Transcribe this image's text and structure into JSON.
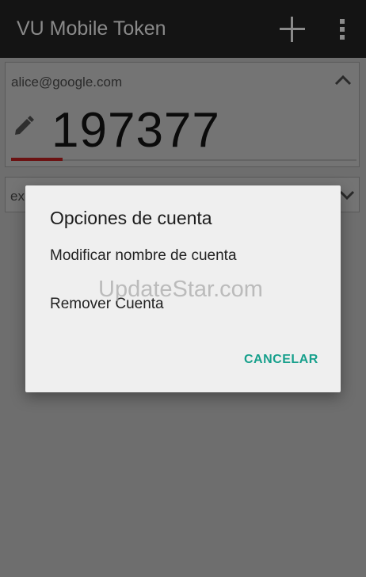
{
  "app": {
    "title": "VU Mobile Token",
    "icons": {
      "add": "plus-icon",
      "menu": "overflow-menu-icon"
    }
  },
  "account": {
    "email": "alice@google.com",
    "code": "197377",
    "progress_fraction": 0.15,
    "icons": {
      "collapse": "chevron-up-icon",
      "edit": "pencil-icon"
    }
  },
  "account2": {
    "label_partial": "ex",
    "icons": {
      "expand": "chevron-down-icon"
    }
  },
  "dialog": {
    "title": "Opciones de cuenta",
    "options": [
      "Modificar nombre de cuenta",
      "Remover Cuenta"
    ],
    "cancel_label": "CANCELAR"
  },
  "watermark": {
    "text": "UpdateStar.com"
  },
  "colors": {
    "accent": "#17a08c",
    "progress": "#c21a1a",
    "appbar": "#141414",
    "dialog_bg": "#efefef"
  }
}
